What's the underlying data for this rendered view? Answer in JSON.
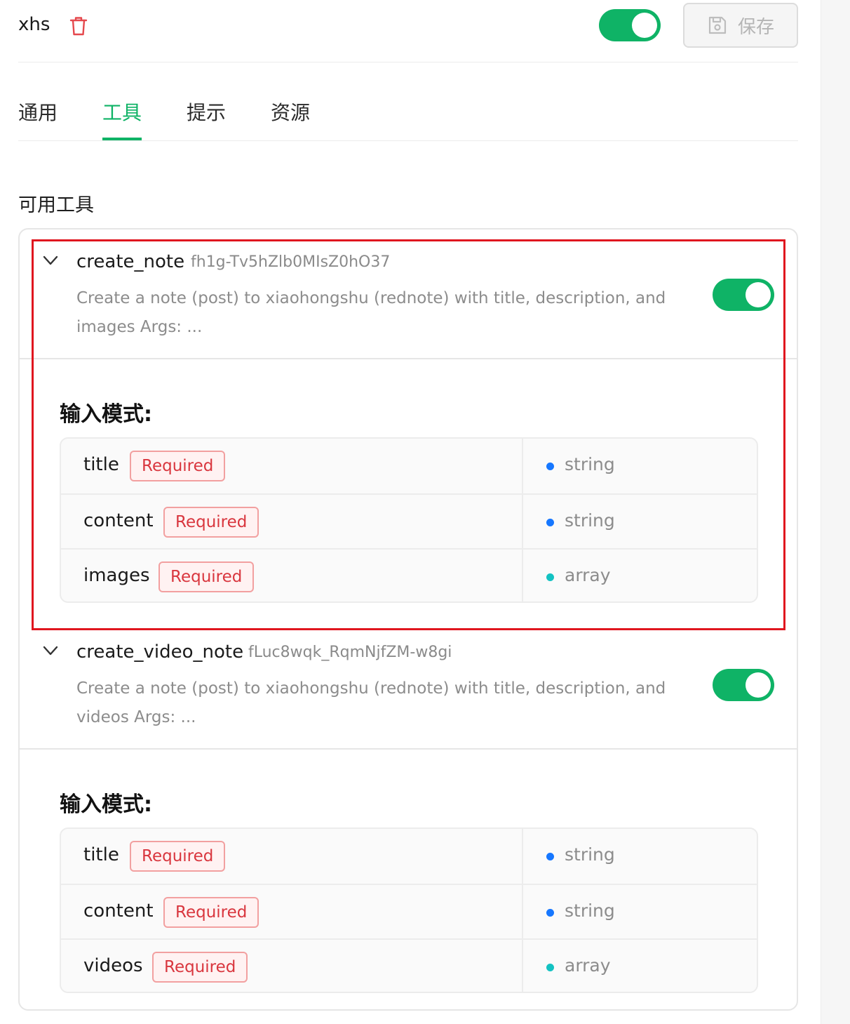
{
  "header": {
    "server_name": "xhs",
    "save_label": "保存",
    "enabled": true
  },
  "tabs": [
    {
      "label": "通用",
      "active": false
    },
    {
      "label": "工具",
      "active": true
    },
    {
      "label": "提示",
      "active": false
    },
    {
      "label": "资源",
      "active": false
    }
  ],
  "section_title": "可用工具",
  "tools": [
    {
      "name": "create_note",
      "id": "fh1g-Tv5hZlb0MIsZ0hO37",
      "description": "Create a note (post) to xiaohongshu (rednote) with title, description, and images Args: ...",
      "enabled": true,
      "schema_title": "输入模式:",
      "params": [
        {
          "name": "title",
          "badge": "Required",
          "type": "string"
        },
        {
          "name": "content",
          "badge": "Required",
          "type": "string"
        },
        {
          "name": "images",
          "badge": "Required",
          "type": "array"
        }
      ]
    },
    {
      "name": "create_video_note",
      "id": "fLuc8wqk_RqmNjfZM-w8gi",
      "description": "Create a note (post) to xiaohongshu (rednote) with title, description, and videos Args: ...",
      "enabled": true,
      "schema_title": "输入模式:",
      "params": [
        {
          "name": "title",
          "badge": "Required",
          "type": "string"
        },
        {
          "name": "content",
          "badge": "Required",
          "type": "string"
        },
        {
          "name": "videos",
          "badge": "Required",
          "type": "array"
        }
      ]
    }
  ],
  "colors": {
    "accent_green": "#0fb366",
    "required_red": "#d9363e",
    "type_string": "#1677ff",
    "type_array": "#13c2c2",
    "highlight": "#e0161f"
  }
}
